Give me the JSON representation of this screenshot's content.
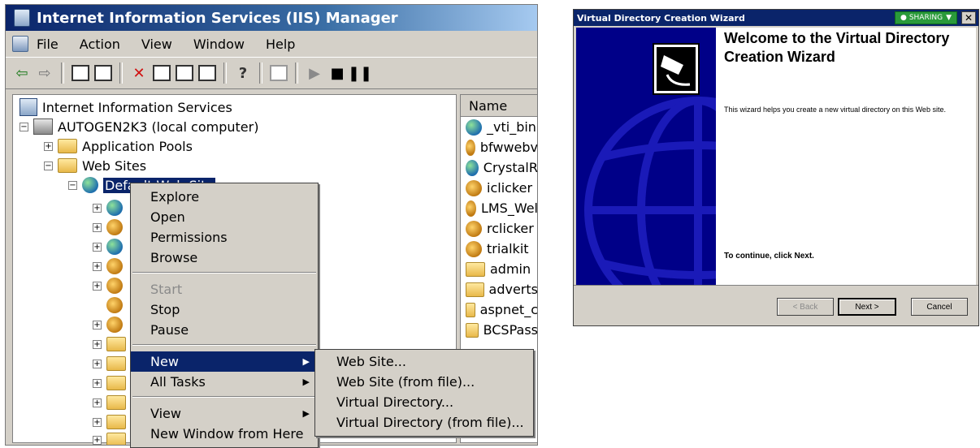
{
  "iis": {
    "title": "Internet Information Services (IIS) Manager",
    "menu": [
      "File",
      "Action",
      "View",
      "Window",
      "Help"
    ],
    "tree": {
      "root": "Internet Information Services",
      "computer": "AUTOGEN2K3 (local computer)",
      "app_pools": "Application Pools",
      "web_sites": "Web Sites",
      "default_site": "Default Web Site"
    },
    "list_header": "Name",
    "list_items": [
      "_vti_bin",
      "bfwwebv",
      "CrystalR",
      "iclicker",
      "LMS_Wel",
      "rclicker",
      "trialkit",
      "admin",
      "adverts",
      "aspnet_c",
      "BCSPass"
    ]
  },
  "context_menu": {
    "items": [
      "Explore",
      "Open",
      "Permissions",
      "Browse",
      "Start",
      "Stop",
      "Pause",
      "New",
      "All Tasks",
      "View",
      "New Window from Here"
    ]
  },
  "new_submenu": {
    "items": [
      "Web Site...",
      "Web Site (from file)...",
      "Virtual Directory...",
      "Virtual Directory (from file)..."
    ]
  },
  "wizard": {
    "title": "Virtual Directory Creation Wizard",
    "sharing_badge": "SHARING",
    "heading": "Welcome to the Virtual Directory Creation Wizard",
    "description": "This wizard helps you create a new virtual directory on this Web site.",
    "continue_text": "To continue, click Next.",
    "back_button": "< Back",
    "next_button": "Next >",
    "cancel_button": "Cancel"
  }
}
